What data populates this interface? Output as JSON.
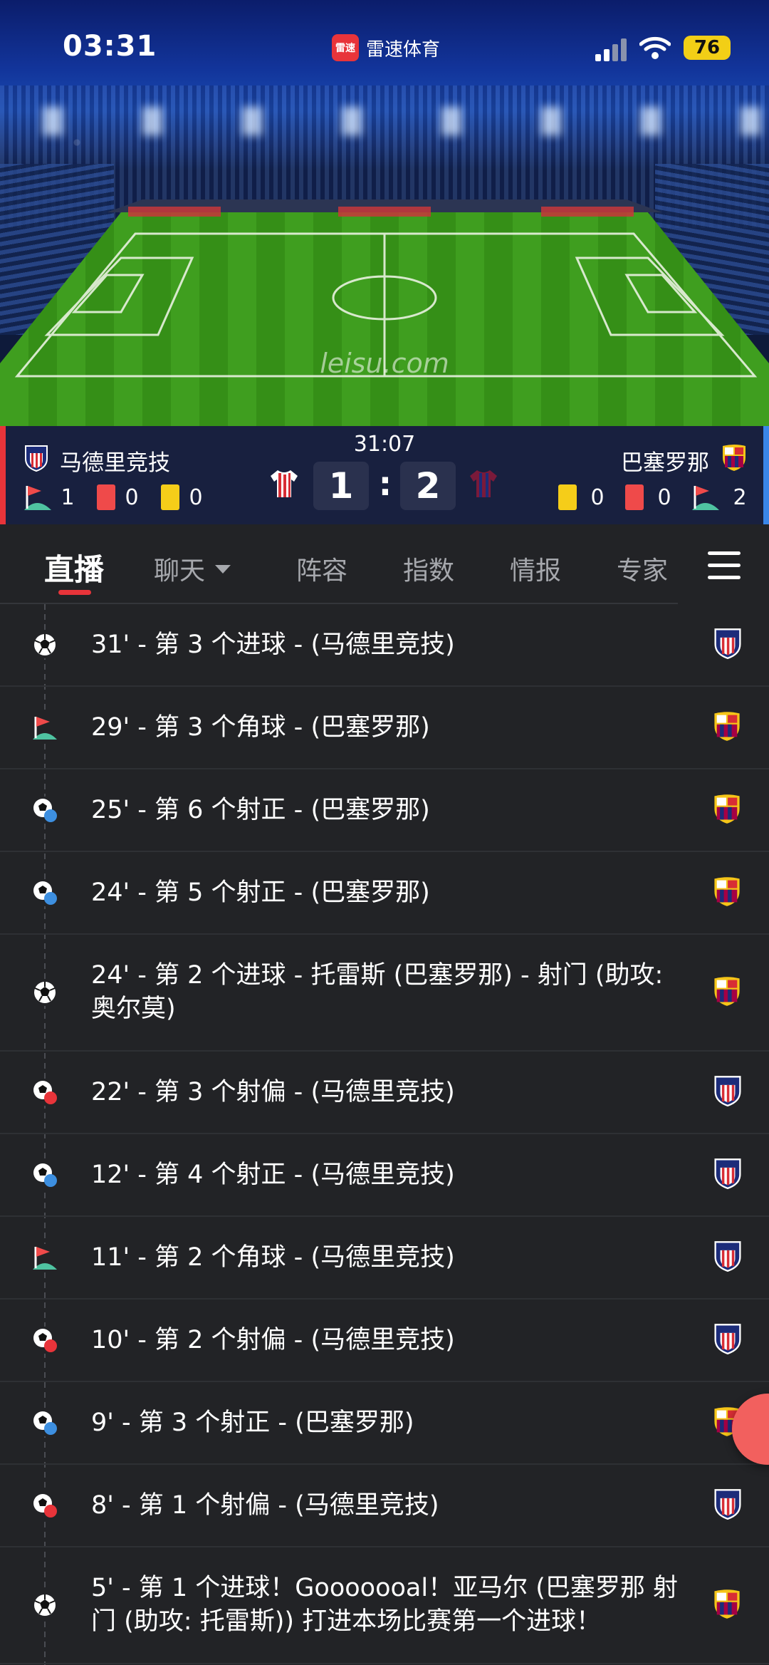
{
  "status_bar": {
    "time": "03:31",
    "app_name": "雷速体育",
    "app_logo_text": "雷速",
    "battery": "76"
  },
  "hero": {
    "watermark": "leisu.com",
    "pitch_color": "#3a9a1c"
  },
  "match": {
    "time": "31:07",
    "home": {
      "name": "马德里竞技",
      "corners": "1",
      "red_cards": "0",
      "yellow_cards": "0",
      "score": "1"
    },
    "away": {
      "name": "巴塞罗那",
      "corners": "2",
      "red_cards": "0",
      "yellow_cards": "0",
      "score": "2"
    },
    "separator": ":"
  },
  "tabs": [
    {
      "label": "直播",
      "active": true
    },
    {
      "label": "聊天",
      "active": false
    },
    {
      "label": "阵容",
      "active": false
    },
    {
      "label": "指数",
      "active": false
    },
    {
      "label": "情报",
      "active": false
    },
    {
      "label": "专家",
      "active": false
    }
  ],
  "events": [
    {
      "text": "31' - 第 3 个进球 - (马德里竞技)",
      "icon": "goal-icon",
      "team": "home"
    },
    {
      "text": "29' - 第 3 个角球 - (巴塞罗那)",
      "icon": "corner-icon",
      "team": "away"
    },
    {
      "text": "25' - 第 6 个射正 - (巴塞罗那)",
      "icon": "shot-on-target-icon",
      "team": "away",
      "badge": "正"
    },
    {
      "text": "24' - 第 5 个射正 - (巴塞罗那)",
      "icon": "shot-on-target-icon",
      "team": "away",
      "badge": "正"
    },
    {
      "text": "24' - 第 2 个进球 - 托雷斯 (巴塞罗那) - 射门 (助攻: 奥尔莫)",
      "icon": "goal-icon",
      "team": "away"
    },
    {
      "text": "22' - 第 3 个射偏 - (马德里竞技)",
      "icon": "shot-off-target-icon",
      "team": "home",
      "badge": "偏"
    },
    {
      "text": "12' - 第 4 个射正 - (马德里竞技)",
      "icon": "shot-on-target-icon",
      "team": "home",
      "badge": "正"
    },
    {
      "text": "11' - 第 2 个角球 - (马德里竞技)",
      "icon": "corner-icon",
      "team": "home"
    },
    {
      "text": "10' - 第 2 个射偏 - (马德里竞技)",
      "icon": "shot-off-target-icon",
      "team": "home",
      "badge": "偏"
    },
    {
      "text": "9' - 第 3 个射正 - (巴塞罗那)",
      "icon": "shot-on-target-icon",
      "team": "away",
      "badge": "正"
    },
    {
      "text": "8' - 第 1 个射偏 - (马德里竞技)",
      "icon": "shot-off-target-icon",
      "team": "home",
      "badge": "偏"
    },
    {
      "text": "5' - 第 1 个进球！Gooooooal！亚马尔 (巴塞罗那 射门 (助攻: 托雷斯)) 打进本场比赛第一个进球！",
      "icon": "goal-icon",
      "team": "away"
    }
  ],
  "colors": {
    "accent": "#e8343a",
    "home_edge": "#e8343a",
    "away_edge": "#3a86e8",
    "background": "#222326"
  }
}
